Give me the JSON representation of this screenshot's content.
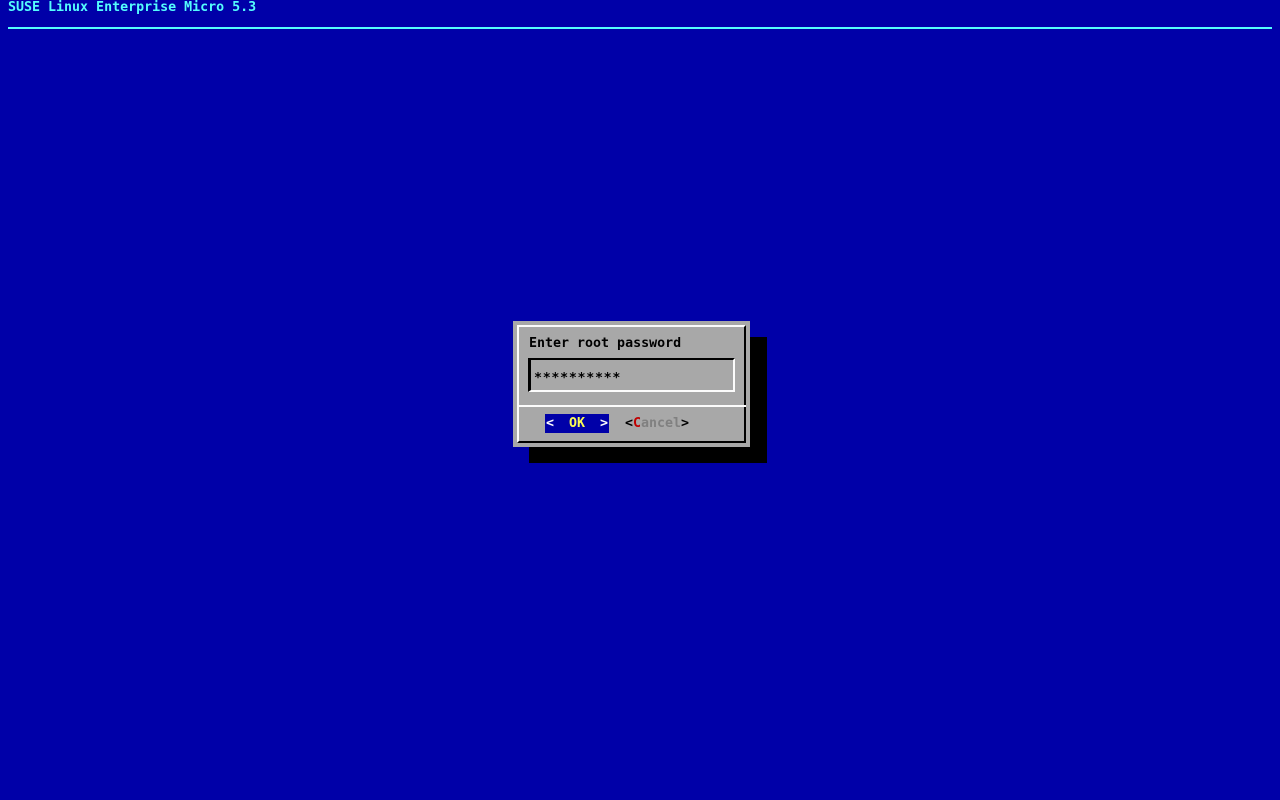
{
  "screen": {
    "title": "SUSE Linux Enterprise Micro 5.3"
  },
  "dialog": {
    "title": "Enter root password",
    "password_mask": "**********",
    "buttons": {
      "ok": {
        "left_bracket": "<",
        "label": "OK",
        "right_bracket": ">"
      },
      "cancel": {
        "left_bracket": "<",
        "shortcut": "C",
        "rest": "ancel",
        "right_bracket": ">"
      }
    }
  },
  "colors": {
    "screen_bg": "#0000A8",
    "header_fg": "#54FCFC",
    "dialog_bg": "#A8A8A8",
    "dialog_fg": "#000000",
    "shadow": "#000000",
    "border_highlight": "#FCFCFC",
    "border_shadow": "#000000",
    "ok_button_bg": "#0000A8",
    "ok_label_fg": "#FCFC54",
    "ok_bracket_fg": "#FCFCFC",
    "cancel_shortcut_fg": "#C00000",
    "cancel_label_fg": "#808080",
    "cancel_bracket_fg": "#000000"
  }
}
